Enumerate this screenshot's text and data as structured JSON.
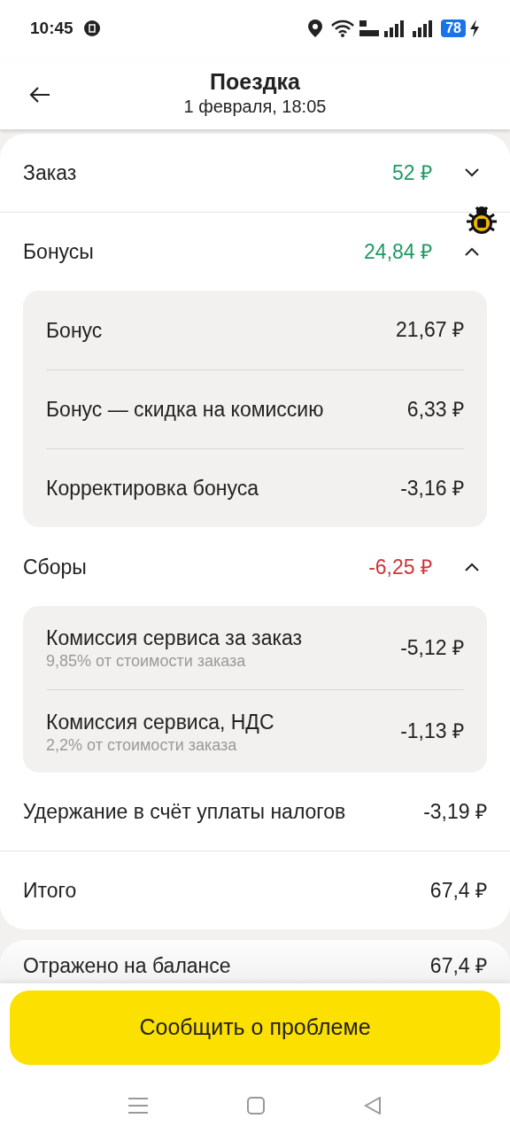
{
  "status_bar": {
    "time": "10:45",
    "battery": "78"
  },
  "header": {
    "title": "Поездка",
    "subtitle": "1 февраля, 18:05"
  },
  "sections": [
    {
      "kind": "section",
      "label": "Заказ",
      "amount": "52 ₽",
      "color": "#1f9a62",
      "expanded": false
    },
    {
      "kind": "section",
      "label": "Бонусы",
      "amount": "24,84 ₽",
      "color": "#1f9a62",
      "expanded": true,
      "items": [
        {
          "label": "Бонус",
          "amount": "21,67 ₽"
        },
        {
          "label": "Бонус — скидка на комиссию",
          "amount": "6,33 ₽"
        },
        {
          "label": "Корректировка бонуса",
          "amount": "-3,16 ₽"
        }
      ]
    },
    {
      "kind": "section",
      "label": "Сборы",
      "amount": "-6,25 ₽",
      "color": "#d0323a",
      "expanded": true,
      "items": [
        {
          "label": "Комиссия сервиса за заказ",
          "note": "9,85% от стоимости заказа",
          "amount": "-5,12 ₽"
        },
        {
          "label": "Комиссия сервиса, НДС",
          "note": "2,2% от стоимости заказа",
          "amount": "-1,13 ₽"
        }
      ]
    },
    {
      "kind": "line",
      "label": "Удержание в счёт уплаты налогов",
      "amount": "-3,19 ₽"
    },
    {
      "kind": "total",
      "label": "Итого",
      "amount": "67,4 ₽"
    }
  ],
  "balance_row": {
    "label": "Отражено на балансе",
    "amount": "67,4 ₽"
  },
  "report_button": "Сообщить о проблеме"
}
